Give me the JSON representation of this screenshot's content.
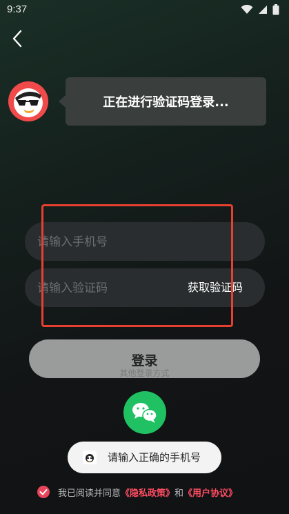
{
  "status_bar": {
    "time": "9:37",
    "icons": [
      "wifi-icon",
      "signal-icon",
      "battery-icon"
    ]
  },
  "header": {
    "back_icon": "chevron-left-icon"
  },
  "assistant": {
    "avatar_icon": "duck-mascot-icon",
    "bubble_text": "正在进行验证码登录..."
  },
  "form": {
    "phone_placeholder": "请输入手机号",
    "phone_value": "",
    "code_placeholder": "请输入验证码",
    "code_value": "",
    "get_code_label": "获取验证码"
  },
  "login_button": {
    "label": "登录"
  },
  "other_login": {
    "label": "其他登录方式",
    "wechat_icon": "wechat-icon"
  },
  "toast": {
    "icon": "app-logo-icon",
    "text": "请输入正确的手机号"
  },
  "agreement": {
    "checked": true,
    "prefix": "我已阅读并同意",
    "privacy_link": "《隐私政策》",
    "conjunction": "和",
    "user_link": "《用户协议》"
  },
  "colors": {
    "accent": "#e8455a",
    "highlight_box": "#e8402f",
    "wechat": "#1fc163",
    "login_button": "#9a9b9b"
  }
}
